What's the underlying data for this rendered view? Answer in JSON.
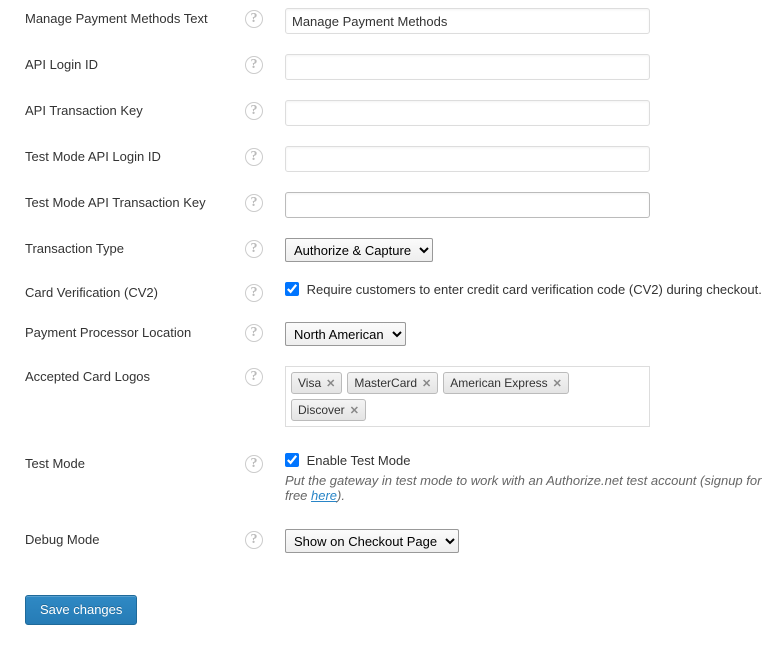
{
  "fields": {
    "manage_payment_methods": {
      "label": "Manage Payment Methods Text",
      "value": "Manage Payment Methods"
    },
    "api_login_id": {
      "label": "API Login ID",
      "value": ""
    },
    "api_transaction_key": {
      "label": "API Transaction Key",
      "value": ""
    },
    "test_api_login_id": {
      "label": "Test Mode API Login ID",
      "value": ""
    },
    "test_api_transaction_key": {
      "label": "Test Mode API Transaction Key",
      "value": ""
    },
    "transaction_type": {
      "label": "Transaction Type",
      "selected": "Authorize & Capture"
    },
    "card_verification": {
      "label": "Card Verification (CV2)",
      "checkbox_label": "Require customers to enter credit card verification code (CV2) during checkout.",
      "checked": true
    },
    "payment_processor_location": {
      "label": "Payment Processor Location",
      "selected": "North American"
    },
    "accepted_card_logos": {
      "label": "Accepted Card Logos",
      "chips": [
        "Visa",
        "MasterCard",
        "American Express",
        "Discover"
      ]
    },
    "test_mode": {
      "label": "Test Mode",
      "checkbox_label": "Enable Test Mode",
      "checked": true,
      "description_prefix": "Put the gateway in test mode to work with an Authorize.net test account (signup for free ",
      "description_link": "here",
      "description_suffix": ")."
    },
    "debug_mode": {
      "label": "Debug Mode",
      "selected": "Show on Checkout Page"
    }
  },
  "submit": {
    "label": "Save changes"
  }
}
